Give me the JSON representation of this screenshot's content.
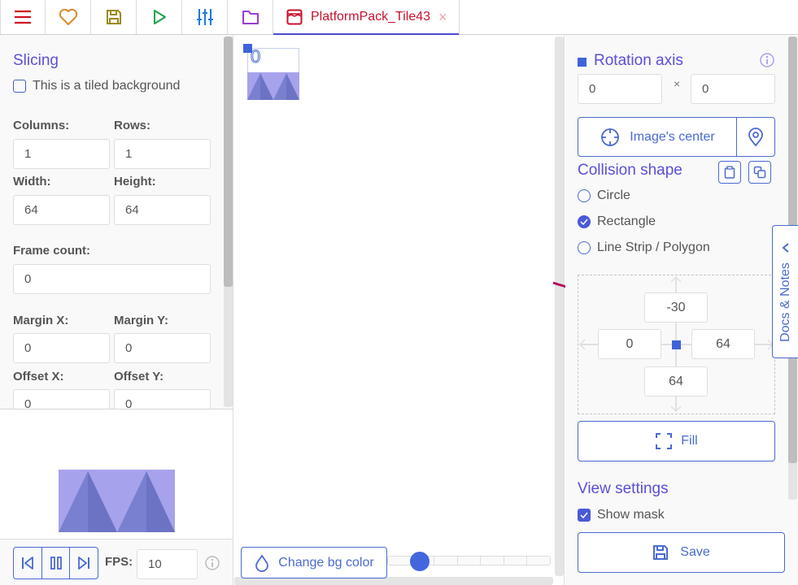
{
  "toolbar": {
    "buttons": [
      {
        "name": "menu",
        "icon": "hamburger-icon",
        "color": "#d01020"
      },
      {
        "name": "favorites",
        "icon": "heart-icon",
        "color": "#d98b2b"
      },
      {
        "name": "save",
        "icon": "floppy-icon",
        "color": "#9a8a16"
      },
      {
        "name": "play",
        "icon": "play-icon",
        "color": "#1aa34a"
      },
      {
        "name": "settings",
        "icon": "sliders-icon",
        "color": "#1a7ae0"
      },
      {
        "name": "assets",
        "icon": "folder-icon",
        "color": "#9a3cd0"
      }
    ],
    "tab": {
      "label": "PlatformPack_Tile43",
      "icon": "texture-icon",
      "close": "×",
      "color": "#c8102e"
    }
  },
  "slicing": {
    "title": "Slicing",
    "tiled_label": "This is a tiled background",
    "tiled_checked": false,
    "columns_label": "Columns:",
    "columns": "1",
    "rows_label": "Rows:",
    "rows": "1",
    "width_label": "Width:",
    "width": "64",
    "height_label": "Height:",
    "height": "64",
    "frame_count_label": "Frame count:",
    "frame_count": "0",
    "margin_x_label": "Margin X:",
    "margin_x": "0",
    "margin_y_label": "Margin Y:",
    "margin_y": "0",
    "offset_x_label": "Offset X:",
    "offset_x": "0",
    "offset_y_label": "Offset Y:",
    "offset_y": "0"
  },
  "animation": {
    "fps_label": "FPS:",
    "fps": "10"
  },
  "canvas": {
    "frame_number": "0",
    "change_bg_label": "Change bg color",
    "zoom_slider_fraction": 0.2
  },
  "rotation": {
    "title": "Rotation axis",
    "x": "0",
    "y": "0",
    "separator": "×",
    "center_button": "Image's center"
  },
  "collision": {
    "title": "Collision shape",
    "options": [
      {
        "label": "Circle",
        "selected": false
      },
      {
        "label": "Rectangle",
        "selected": true
      },
      {
        "label": "Line Strip / Polygon",
        "selected": false
      }
    ],
    "top": "-30",
    "left": "0",
    "right": "64",
    "bottom": "64",
    "fill_button": "Fill"
  },
  "view_settings": {
    "title": "View settings",
    "show_mask_label": "Show mask",
    "show_mask_checked": true
  },
  "save_button": "Save",
  "docs_tab": "Docs & Notes",
  "colors": {
    "accent": "#4a6ad0",
    "title": "#5a4fd8",
    "annotation": "#b0105a",
    "tile": "#a7a2ec"
  }
}
